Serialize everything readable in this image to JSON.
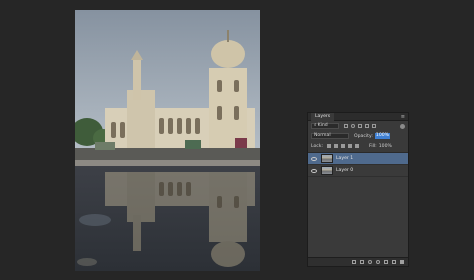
{
  "canvas": {
    "image_name": "mosque-reflection-photo"
  },
  "layers_panel": {
    "tab_label": "Layers",
    "menu_icon": "panel-menu-icon",
    "filter_kind": "Kind",
    "blend_mode": "Normal",
    "opacity_label": "Opacity:",
    "opacity_value": "100%",
    "lock_label": "Lock:",
    "fill_label": "Fill:",
    "fill_value": "100%",
    "layers": [
      {
        "name": "Layer 1",
        "selected": true
      },
      {
        "name": "Layer 0",
        "selected": false
      }
    ],
    "colors": {
      "selection": "#4f6a8d",
      "panel_bg": "#3a3a3a",
      "app_bg": "#262626",
      "highlight": "#3f7fd1"
    }
  }
}
